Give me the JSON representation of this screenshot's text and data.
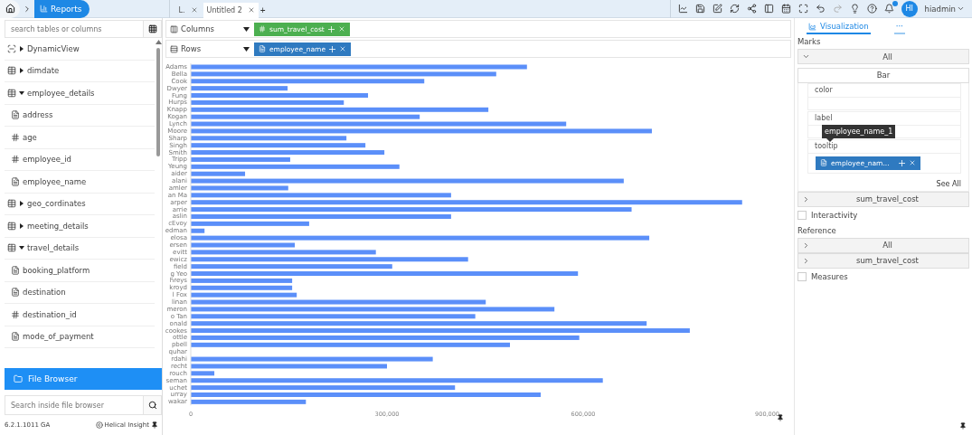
{
  "topbar": {
    "breadcrumb": "Reports",
    "tabs": [
      {
        "label": "L.",
        "selected": false
      },
      {
        "label": "Untitled 2",
        "selected": true
      }
    ],
    "add_tab": "+",
    "user": {
      "initials": "HI",
      "name": "hiadmin"
    }
  },
  "left_panel": {
    "search": {
      "placeholder": "search tables or columns"
    },
    "tree": [
      {
        "label": "DynamicView",
        "kind": "view",
        "expanded": false
      },
      {
        "label": "dimdate",
        "kind": "table",
        "expanded": false
      },
      {
        "label": "employee_details",
        "kind": "table",
        "expanded": true,
        "children": [
          {
            "label": "address",
            "kind": "text"
          },
          {
            "label": "age",
            "kind": "number"
          },
          {
            "label": "employee_id",
            "kind": "number"
          },
          {
            "label": "employee_name",
            "kind": "text"
          }
        ]
      },
      {
        "label": "geo_cordinates",
        "kind": "table",
        "expanded": false
      },
      {
        "label": "meeting_details",
        "kind": "table",
        "expanded": false
      },
      {
        "label": "travel_details",
        "kind": "table",
        "expanded": true,
        "children": [
          {
            "label": "booking_platform",
            "kind": "text"
          },
          {
            "label": "destination",
            "kind": "text"
          },
          {
            "label": "destination_id",
            "kind": "number"
          },
          {
            "label": "mode_of_payment",
            "kind": "text"
          }
        ]
      }
    ],
    "file_browser": "File Browser",
    "file_search": {
      "placeholder": "Search inside file browser"
    },
    "version": "6.2.1.1011 GA",
    "brand": "Helical Insight"
  },
  "shelves": [
    {
      "label": "Columns",
      "kind": "columns",
      "pill": {
        "label": "sum_travel_cost",
        "kind": "measure"
      }
    },
    {
      "label": "Rows",
      "kind": "rows",
      "pill": {
        "label": "employee_name",
        "kind": "dimension"
      }
    }
  ],
  "chart_data": {
    "type": "bar",
    "orientation": "horizontal",
    "categories": [
      "Adams",
      "Bella",
      "Cook",
      "Dwyer",
      "Fung",
      "Hurps",
      "Knapp",
      "Kogan",
      "Lynch",
      "Moore",
      "Sharp",
      "Singh",
      "Smith",
      "Tripp",
      "Yeung",
      "aider",
      "alani",
      "amler",
      "an Ma",
      "arper",
      "arrie",
      "aslin",
      "cEvoy",
      "edman",
      "elosa",
      "ersen",
      "evitt",
      "ewicz",
      "field",
      "g Yeo",
      "hreys",
      "kroyd",
      "l Fox",
      "linan",
      "meron",
      "o Tan",
      "onald",
      "cookes",
      "ottle",
      "pbell",
      "quhar",
      "rdahi",
      "recht",
      "rouch",
      "seman",
      "uchet",
      "urray",
      "wakar"
    ],
    "series": [
      {
        "color": "#5b8ff9",
        "values": [
          514000,
          467000,
          357000,
          148000,
          271000,
          234000,
          455000,
          350000,
          574000,
          705000,
          238000,
          267000,
          296000,
          152000,
          319000,
          83000,
          662000,
          149000,
          398000,
          843000,
          674000,
          398000,
          181000,
          21000,
          701000,
          159000,
          283000,
          424000,
          308000,
          592000,
          155000,
          155000,
          162000,
          451000,
          556000,
          435000,
          697000,
          763000,
          594000,
          488000,
          null,
          370000,
          300000,
          36000,
          630000,
          404000,
          535000,
          176000
        ]
      }
    ],
    "xlim": [
      0,
      900000
    ],
    "xticks": [
      {
        "value": 0,
        "label": "0"
      },
      {
        "value": 300000,
        "label": "300,000"
      },
      {
        "value": 600000,
        "label": "600,000"
      },
      {
        "value": 900000,
        "label": "900,000"
      }
    ]
  },
  "right_panel": {
    "tabs": [
      {
        "label": "Visualization",
        "selected": true
      },
      {
        "label": "···",
        "selected": false
      }
    ],
    "marks_title": "Marks",
    "marks_groups": [
      {
        "label": "All",
        "expanded": true,
        "chart_type": "Bar",
        "slots": [
          {
            "label": "color"
          },
          {
            "label": "label"
          },
          {
            "label": "tooltip",
            "pill": "employee_nam...",
            "hint": "employee_name_1"
          }
        ],
        "see_all": "See All"
      },
      {
        "label": "sum_travel_cost",
        "expanded": false
      }
    ],
    "interactivity": {
      "label": "Interactivity",
      "checked": false
    },
    "reference_title": "Reference",
    "reference_groups": [
      {
        "label": "All",
        "expanded": false
      },
      {
        "label": "sum_travel_cost",
        "expanded": false
      }
    ],
    "measures": {
      "label": "Measures",
      "checked": false
    }
  }
}
